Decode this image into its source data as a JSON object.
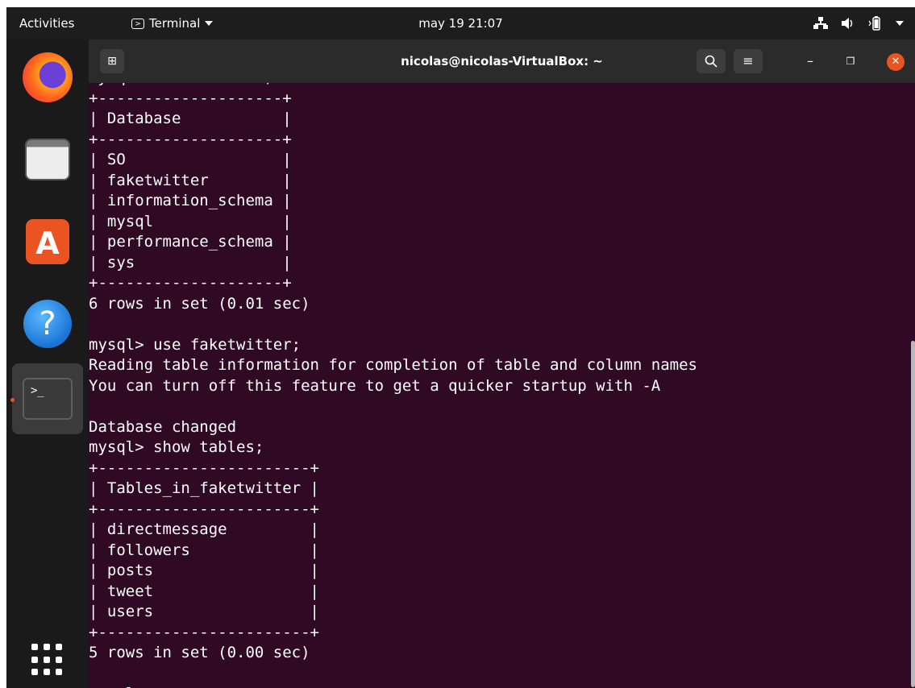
{
  "topbar": {
    "activities": "Activities",
    "app_name": "Terminal",
    "clock": "may 19  21:07",
    "tray_icons": [
      "network-icon",
      "volume-icon",
      "battery-icon",
      "system-menu-icon"
    ]
  },
  "dock": {
    "apps": [
      {
        "name": "Firefox",
        "icon": "firefox-icon"
      },
      {
        "name": "Files",
        "icon": "files-icon"
      },
      {
        "name": "Ubuntu Software",
        "icon": "software-icon"
      },
      {
        "name": "Help",
        "icon": "help-icon"
      },
      {
        "name": "Terminal",
        "icon": "terminal-icon",
        "active": true
      }
    ],
    "show_apps": "show-applications-icon"
  },
  "window": {
    "title": "nicolas@nicolas-VirtualBox: ~",
    "new_tab_glyph": "⊞",
    "search_glyph": "⌕",
    "menu_glyph": "≡",
    "minimize_glyph": "–",
    "maximize_glyph": "❐",
    "close_glyph": "✕"
  },
  "terminal": {
    "lines": [
      "mysql> show schemas;",
      "+--------------------+",
      "| Database           |",
      "+--------------------+",
      "| SO                 |",
      "| faketwitter        |",
      "| information_schema |",
      "| mysql              |",
      "| performance_schema |",
      "| sys                |",
      "+--------------------+",
      "6 rows in set (0.01 sec)",
      "",
      "mysql> use faketwitter;",
      "Reading table information for completion of table and column names",
      "You can turn off this feature to get a quicker startup with -A",
      "",
      "Database changed",
      "mysql> show tables;",
      "+-----------------------+",
      "| Tables_in_faketwitter |",
      "+-----------------------+",
      "| directmessage         |",
      "| followers             |",
      "| posts                 |",
      "| tweet                 |",
      "| users                 |",
      "+-----------------------+",
      "5 rows in set (0.00 sec)",
      "",
      "mysql> "
    ]
  }
}
